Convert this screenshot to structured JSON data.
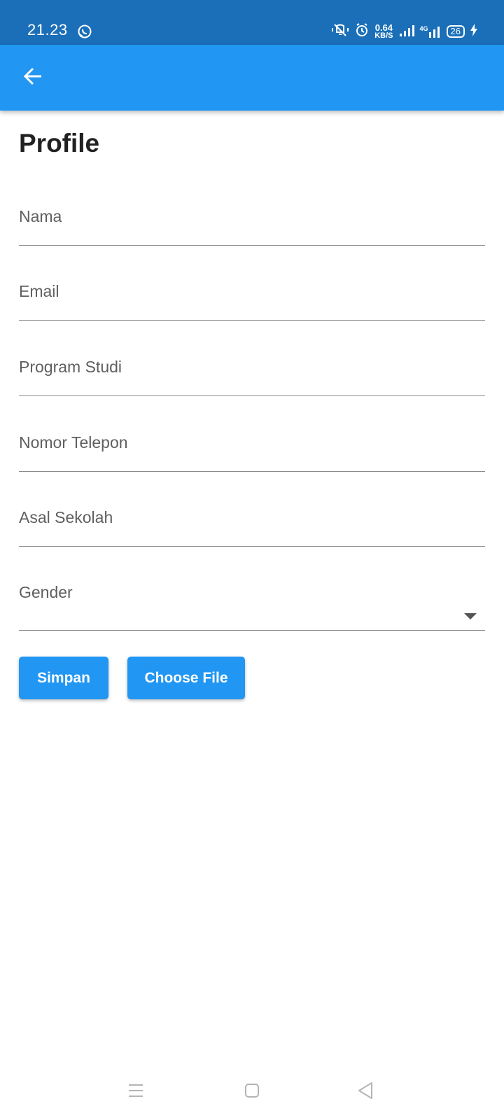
{
  "status_bar": {
    "time": "21.23",
    "net_speed_value": "0.64",
    "net_speed_unit": "KB/S",
    "network_type": "4G",
    "battery_level": "26",
    "color": "#1b6fb8"
  },
  "app_bar": {
    "color": "#2196f3",
    "back_icon": "arrow-left-icon"
  },
  "page": {
    "title": "Profile"
  },
  "form": {
    "fields": [
      {
        "placeholder": "Nama",
        "value": ""
      },
      {
        "placeholder": "Email",
        "value": ""
      },
      {
        "placeholder": "Program Studi",
        "value": ""
      },
      {
        "placeholder": "Nomor Telepon",
        "value": ""
      },
      {
        "placeholder": "Asal Sekolah",
        "value": ""
      }
    ],
    "gender": {
      "placeholder": "Gender",
      "selected": ""
    }
  },
  "buttons": {
    "save_label": "Simpan",
    "choose_file_label": "Choose File"
  },
  "nav_bar": {
    "icons": [
      "menu-icon",
      "home-icon",
      "back-triangle-icon"
    ]
  }
}
